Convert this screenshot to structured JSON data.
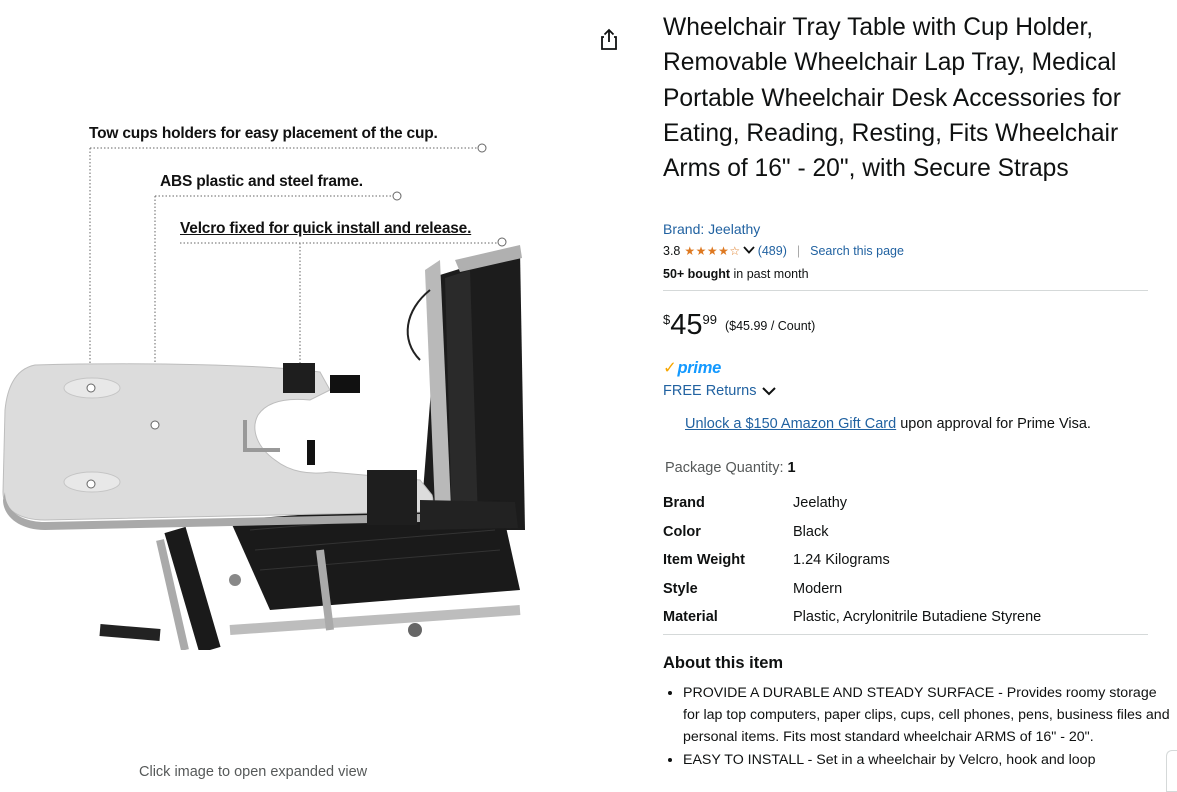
{
  "left_panel": {
    "callouts": [
      "Tow cups holders for easy placement of the cup.",
      "ABS plastic and steel frame.",
      "Velcro fixed for quick install and release."
    ],
    "expand_hint": "Click image to open expanded view"
  },
  "product": {
    "title": "Wheelchair Tray Table with Cup Holder, Removable Wheelchair Lap Tray, Medical Portable Wheelchair Desk Accessories for Eating, Reading, Resting, Fits Wheelchair Arms of 16\" - 20\", with Secure Straps",
    "brand_link": "Brand: Jeelathy",
    "rating": "3.8",
    "rating_stars": "★★★★☆",
    "rating_value": 3.8,
    "review_count": "(489)",
    "search_link": "Search this page",
    "bought_bold": "50+ bought",
    "bought_rest": " in past month"
  },
  "price": {
    "symbol": "$",
    "whole": "45",
    "fraction": "99",
    "unit_price": "($45.99 / Count)"
  },
  "prime": {
    "logo_check": "✓",
    "logo_text": "prime",
    "free_returns": "FREE Returns"
  },
  "offer": {
    "link": "Unlock a $150 Amazon Gift Card",
    "rest": " upon approval for Prime Visa."
  },
  "package": {
    "label": "Package Quantity:",
    "value": "1"
  },
  "specs": [
    {
      "key": "Brand",
      "value": "Jeelathy"
    },
    {
      "key": "Color",
      "value": "Black"
    },
    {
      "key": "Item Weight",
      "value": "1.24 Kilograms"
    },
    {
      "key": "Style",
      "value": "Modern"
    },
    {
      "key": "Material",
      "value": "Plastic, Acrylonitrile Butadiene Styrene"
    }
  ],
  "about": {
    "heading": "About this item",
    "bullets": [
      "PROVIDE A DURABLE AND STEADY SURFACE - Provides roomy storage for lap top computers, paper clips, cups, cell phones, pens, business files and personal items. Fits most standard wheelchair ARMS of 16\" - 20\".",
      "EASY TO INSTALL - Set in a wheelchair by Velcro, hook and loop"
    ]
  },
  "colors": {
    "link": "#2162a1",
    "star": "#de7921",
    "prime_blue": "#1399ff",
    "prime_check": "#f7a600",
    "muted": "#565959"
  }
}
